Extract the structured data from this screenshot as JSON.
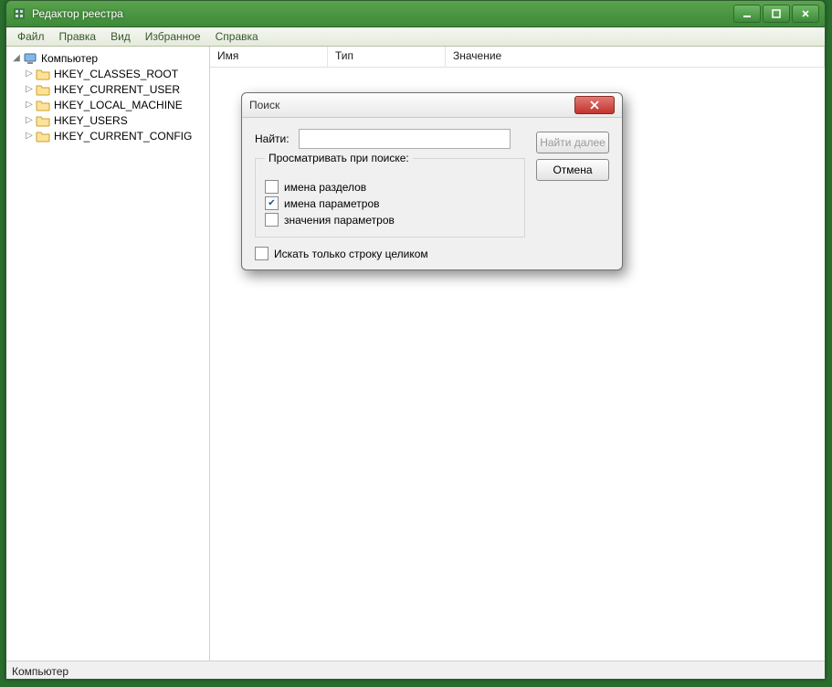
{
  "window": {
    "title": "Редактор реестра"
  },
  "menu": {
    "file": "Файл",
    "edit": "Правка",
    "view": "Вид",
    "fav": "Избранное",
    "help": "Справка"
  },
  "tree": {
    "root": "Компьютер",
    "items": [
      "HKEY_CLASSES_ROOT",
      "HKEY_CURRENT_USER",
      "HKEY_LOCAL_MACHINE",
      "HKEY_USERS",
      "HKEY_CURRENT_CONFIG"
    ]
  },
  "columns": {
    "name": "Имя",
    "type": "Тип",
    "value": "Значение"
  },
  "statusbar": "Компьютер",
  "dialog": {
    "title": "Поиск",
    "find_label": "Найти:",
    "find_value": "",
    "findnext": "Найти далее",
    "cancel": "Отмена",
    "group_legend": "Просматривать при поиске:",
    "chk_keys": "имена разделов",
    "chk_values": "имена параметров",
    "chk_data": "значения параметров",
    "chk_whole": "Искать только строку целиком",
    "checked": {
      "keys": false,
      "values": true,
      "data": false,
      "whole": false
    }
  }
}
